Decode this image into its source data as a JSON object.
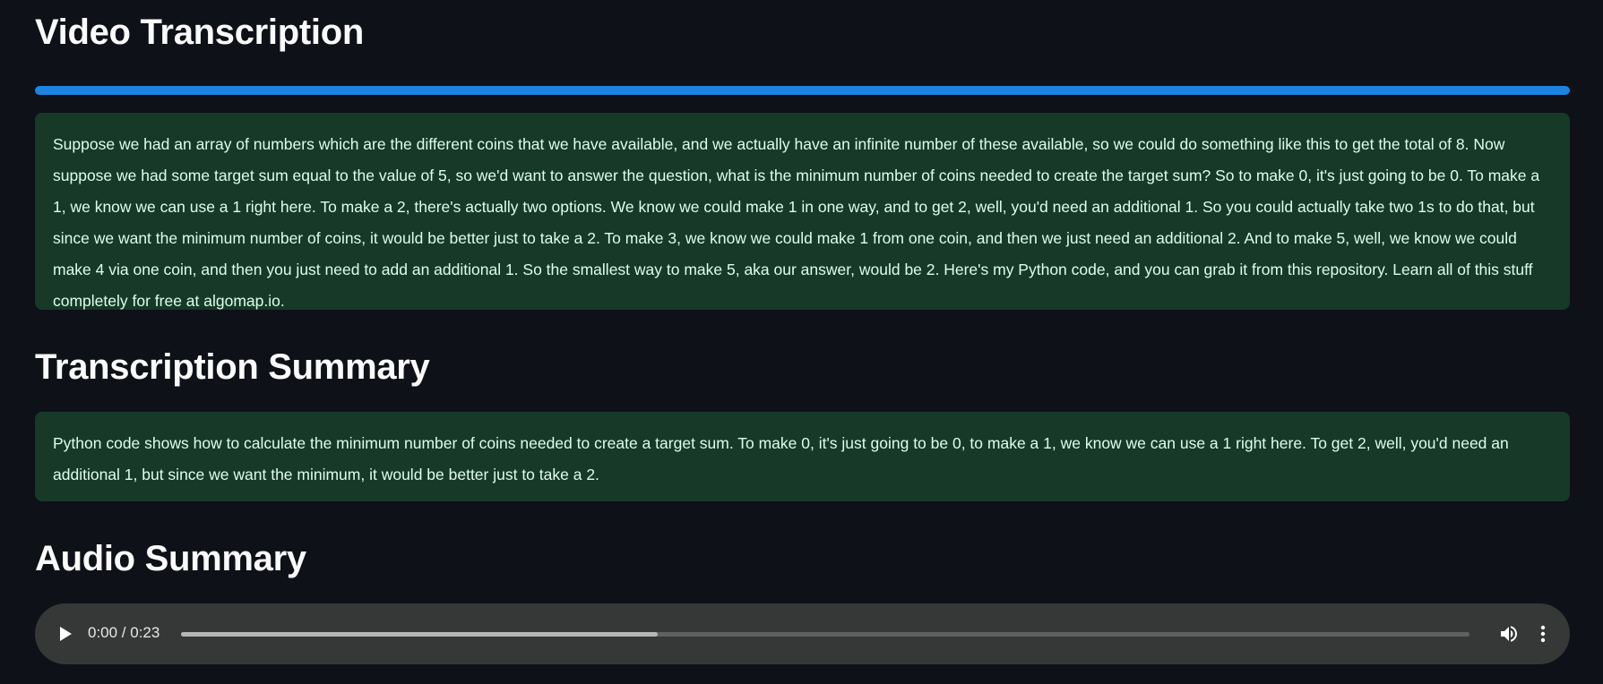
{
  "sections": {
    "video_transcription": {
      "title": "Video Transcription",
      "progress_percent": 100,
      "text": "Suppose we had an array of numbers which are the different coins that we have available, and we actually have an infinite number of these available, so we could do something like this to get the total of 8. Now suppose we had some target sum equal to the value of 5, so we'd want to answer the question, what is the minimum number of coins needed to create the target sum? So to make 0, it's just going to be 0. To make a 1, we know we can use a 1 right here. To make a 2, there's actually two options. We know we could make 1 in one way, and to get 2, well, you'd need an additional 1. So you could actually take two 1s to do that, but since we want the minimum number of coins, it would be better just to take a 2. To make 3, we know we could make 1 from one coin, and then we just need an additional 2. And to make 5, well, we know we could make 4 via one coin, and then you just need to add an additional 1. So the smallest way to make 5, aka our answer, would be 2. Here's my Python code, and you can grab it from this repository. Learn all of this stuff completely for free at algomap.io."
    },
    "transcription_summary": {
      "title": "Transcription Summary",
      "text": "Python code shows how to calculate the minimum number of coins needed to create a target sum. To make 0, it's just going to be 0, to make a 1, we know we can use a 1 right here. To get 2, well, you'd need an additional 1, but since we want the minimum, it would be better just to take a 2."
    },
    "audio_summary": {
      "title": "Audio Summary",
      "time_display": "0:00 / 0:23",
      "buffered_percent": 37,
      "icons": [
        "play-icon",
        "volume-icon",
        "more-options-icon"
      ]
    }
  },
  "colors": {
    "background": "#0e1117",
    "progress": "#1c83e1",
    "success_box": "#173928",
    "success_text": "#dffde9",
    "player": "#363838"
  }
}
